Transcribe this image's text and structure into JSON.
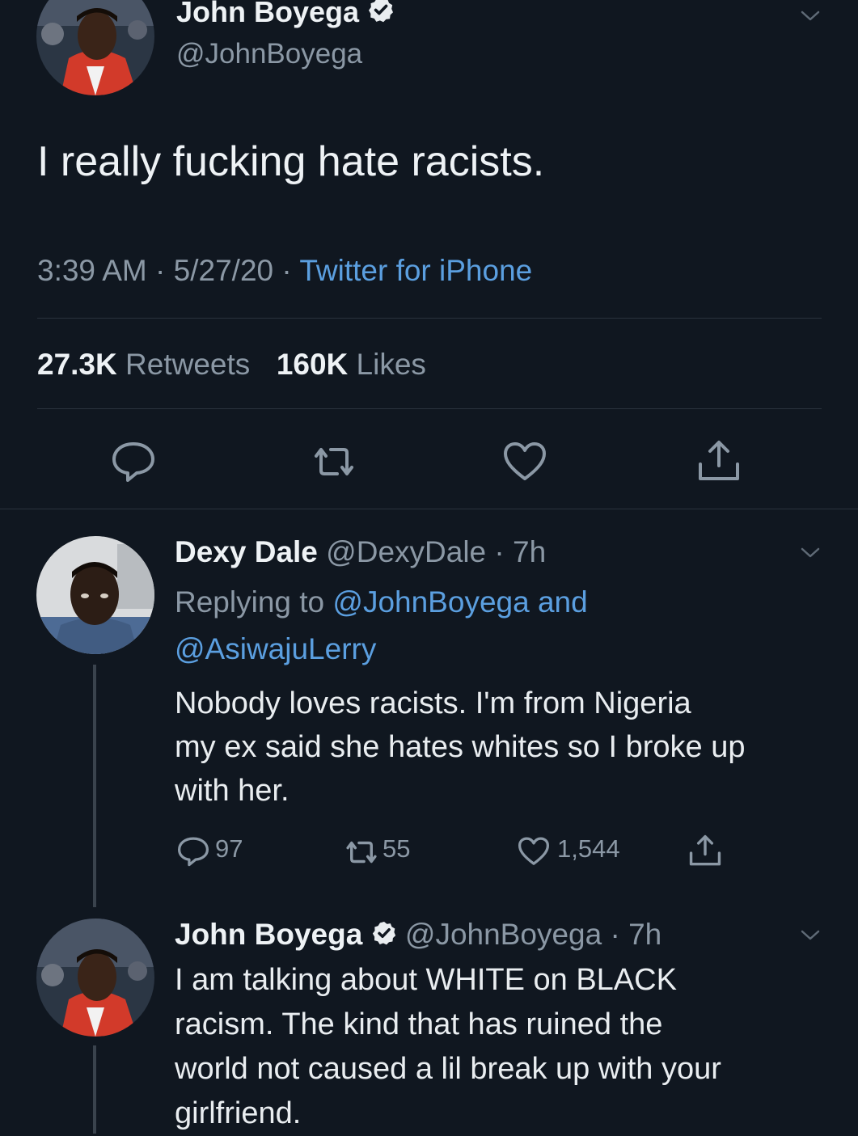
{
  "main_tweet": {
    "author_name": "John Boyega",
    "author_handle": "@JohnBoyega",
    "text": "I really fucking hate racists.",
    "time": "3:39 AM",
    "date": "5/27/20",
    "source": "Twitter for iPhone",
    "retweets_count": "27.3K",
    "retweets_label": "Retweets",
    "likes_count": "160K",
    "likes_label": "Likes"
  },
  "replies": [
    {
      "author_name": "Dexy Dale",
      "author_handle": "@DexyDale",
      "age": "7h",
      "replying_prefix": "Replying to",
      "replying_to_1": "@JohnBoyega",
      "replying_and": "and",
      "replying_to_2": "@AsiwajuLerry",
      "text_line_1": "Nobody loves racists. I'm from Nigeria",
      "text_line_2": "my ex said she hates whites so I broke up",
      "text_line_3": "with her.",
      "reply_count": "97",
      "retweet_count": "55",
      "like_count": "1,544"
    },
    {
      "author_name": "John Boyega",
      "author_handle": "@JohnBoyega",
      "age": "7h",
      "text_line_1": "I am talking about WHITE on BLACK",
      "text_line_2": "racism. The kind that has ruined the",
      "text_line_3": "world not caused a lil break up with your",
      "text_line_4": "girlfriend."
    }
  ],
  "icons": [
    "chevron-down-icon",
    "verified-badge-icon",
    "reply-icon",
    "retweet-icon",
    "like-icon",
    "share-icon"
  ],
  "colors": {
    "background": "#101720",
    "link": "#5b9fe0",
    "muted": "#8b98a5",
    "text": "#e6ebef"
  }
}
